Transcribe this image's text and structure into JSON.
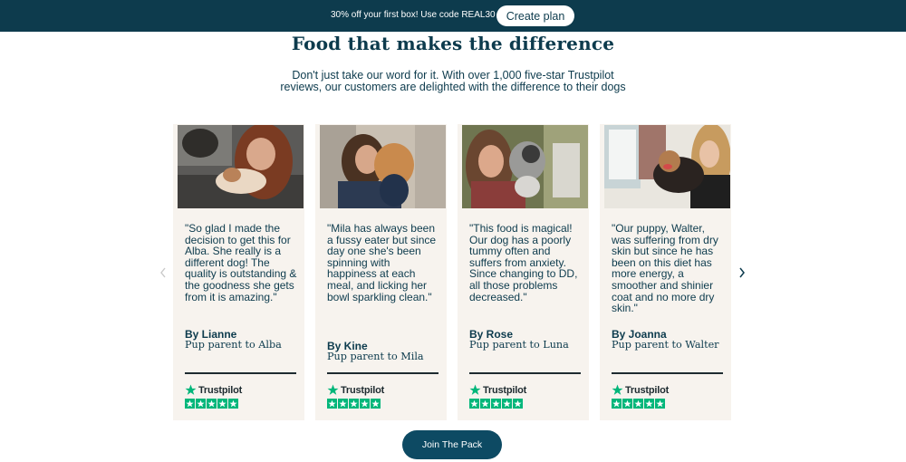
{
  "promo": {
    "text": "30% off your first box! Use code REAL30",
    "button_label": "Create plan"
  },
  "section": {
    "title": "Food that makes the difference",
    "subtitle": "Don't just take our word for it. With over 1,000 five-star Trustpilot reviews, our customers are delighted with the difference to their dogs"
  },
  "reviews": [
    {
      "quote": "\"So glad I made the decision to get this for Alba. She really is a different dog! The quality is outstanding & the goodness she gets from it is amazing.\"",
      "author": "By Lianne",
      "role": "Pup parent to Alba",
      "trustpilot": "Trustpilot",
      "stars": 5
    },
    {
      "quote": "\"Mila has always been a fussy eater but since day one she's been spinning with happiness at each meal, and licking her bowl sparkling clean.\"",
      "author": "By Kine",
      "role": "Pup parent to Mila",
      "trustpilot": "Trustpilot",
      "stars": 5
    },
    {
      "quote": "\"This food is magical! Our dog has a poorly tummy often and suffers from anxiety. Since changing to DD, all those problems decreased.\"",
      "author": "By Rose",
      "role": "Pup parent to Luna",
      "trustpilot": "Trustpilot",
      "stars": 5
    },
    {
      "quote": "\"Our puppy, Walter, was suffering from dry skin but since he has been on this diet has more energy, a smoother and shinier coat and no more dry skin.\"",
      "author": "By Joanna",
      "role": "Pup parent to Walter",
      "trustpilot": "Trustpilot",
      "stars": 5
    }
  ],
  "cta": {
    "label": "Join The Pack"
  },
  "colors": {
    "brand_dark": "#0d3b4d",
    "card_bg": "#f7f3ee",
    "trustpilot_green": "#00b67a"
  },
  "icons": {
    "prev": "chevron-left-icon",
    "next": "chevron-right-icon",
    "trustpilot": "trustpilot-star-icon"
  }
}
